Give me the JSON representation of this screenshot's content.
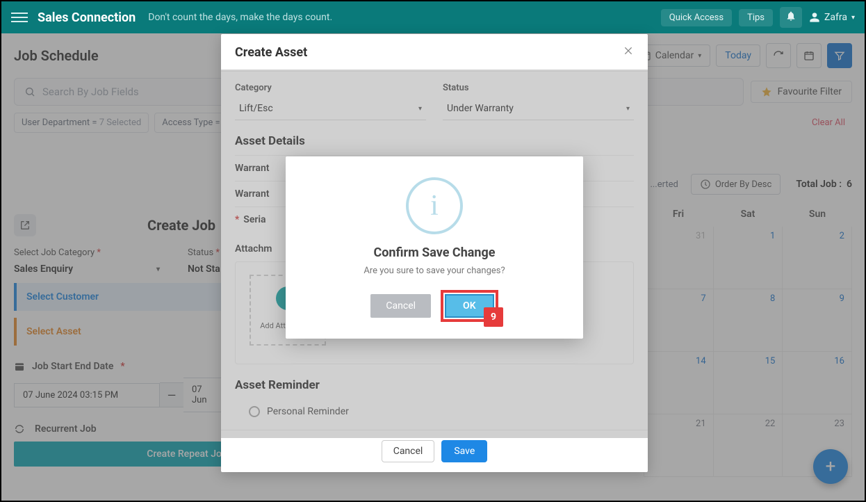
{
  "topbar": {
    "brand": "Sales Connection",
    "motto": "Don't count the days, make the days count.",
    "quick_access": "Quick Access",
    "tips": "Tips",
    "user_name": "Zafra"
  },
  "page": {
    "title": "Job Schedule",
    "calendar_label": "Calendar",
    "today_label": "Today",
    "search_placeholder": "Search By Job Fields",
    "favourite_filter": "Favourite Filter",
    "clear_all": "Clear All",
    "order_by": "Order By Desc",
    "total_job_label": "Total Job :",
    "total_job_count": "6"
  },
  "filters": [
    {
      "key": "User Department =",
      "val": "7 Selected"
    },
    {
      "key": "Access Type =",
      "val": ""
    }
  ],
  "toolbar_extra": {
    "item": "...erted"
  },
  "calendar": {
    "days": [
      "Fri",
      "Sat",
      "Sun"
    ],
    "cells": [
      {
        "n": "31",
        "muted": true
      },
      {
        "n": "1",
        "blue": true
      },
      {
        "n": "2",
        "blue": true
      },
      {
        "n": "7",
        "blue": true
      },
      {
        "n": "8",
        "blue": true
      },
      {
        "n": "9",
        "blue": true
      },
      {
        "n": "14",
        "blue": true
      },
      {
        "n": "15",
        "blue": true
      },
      {
        "n": "16",
        "blue": true
      },
      {
        "n": "21"
      },
      {
        "n": "22"
      },
      {
        "n": "23"
      }
    ]
  },
  "create_job": {
    "title": "Create Job",
    "cat_label": "Select Job Category",
    "cat_value": "Sales Enquiry",
    "status_label": "Status",
    "status_value": "Not Sta",
    "select_customer": "Select Customer",
    "select_asset": "Select Asset",
    "date_label": "Job Start End Date",
    "start_date": "07 June 2024 03:15 PM",
    "end_date": "07 Jun",
    "recurrent": "Recurrent Job",
    "create_repeat": "Create Repeat Job"
  },
  "modal": {
    "title": "Create Asset",
    "category_label": "Category",
    "category_value": "Lift/Esc",
    "status_label": "Status",
    "status_value": "Under Warranty",
    "section_details": "Asset Details",
    "row_warranty1": "Warrant",
    "row_warranty2": "Warrant",
    "row_serial": "Seria",
    "attachments_label": "Attachm",
    "add_attachment": "Add Attachment",
    "section_reminder": "Asset Reminder",
    "reminder_personal": "Personal Reminder",
    "cancel": "Cancel",
    "save": "Save"
  },
  "confirm": {
    "title": "Confirm Save Change",
    "message": "Are you sure to save your changes?",
    "cancel": "Cancel",
    "ok": "OK",
    "step": "9"
  }
}
